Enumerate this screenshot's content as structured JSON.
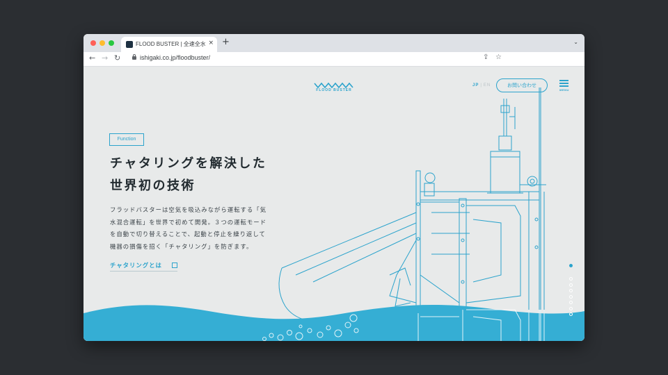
{
  "browser": {
    "tab_title": "FLOOD BUSTER | 全速全水位型",
    "tab_close": "×",
    "new_tab": "+",
    "url": "ishigaki.co.jp/floodbuster/",
    "back": "←",
    "forward": "→",
    "reload": "↻",
    "share": "⇪",
    "star": "☆",
    "tab_menu": "⌄"
  },
  "site": {
    "logo_text": "FLOOD BUSTER",
    "lang_jp": "JP",
    "lang_sep": "|",
    "lang_en": "EN",
    "contact": "お問い合わせ",
    "menu_label": "MENU"
  },
  "hero": {
    "badge": "Function",
    "headline_line1": "チャタリングを解決した",
    "headline_line2": "世界初の技術",
    "body_lines": [
      "フラッドバスターは空気を吸込みながら運転する「気",
      "水混合運転」を世界で初めて開発。３つの運転モード",
      "を自動で切り替えることで、起動と停止を繰り返して",
      "機器の損傷を招く「チャタリング」を防ぎます。"
    ],
    "link_label": "チャタリングとは"
  },
  "pager": {
    "count": 8,
    "active_index": 0
  },
  "colors": {
    "accent": "#2ba3cc",
    "water": "#35aed4",
    "background": "#e8eaea",
    "text": "#222b30"
  },
  "icons": {
    "favicon": "flood-buster-favicon",
    "lock": "lock-icon",
    "share": "share-icon",
    "star": "bookmark-star-icon",
    "menu": "hamburger-menu-icon",
    "external": "external-link-icon"
  }
}
